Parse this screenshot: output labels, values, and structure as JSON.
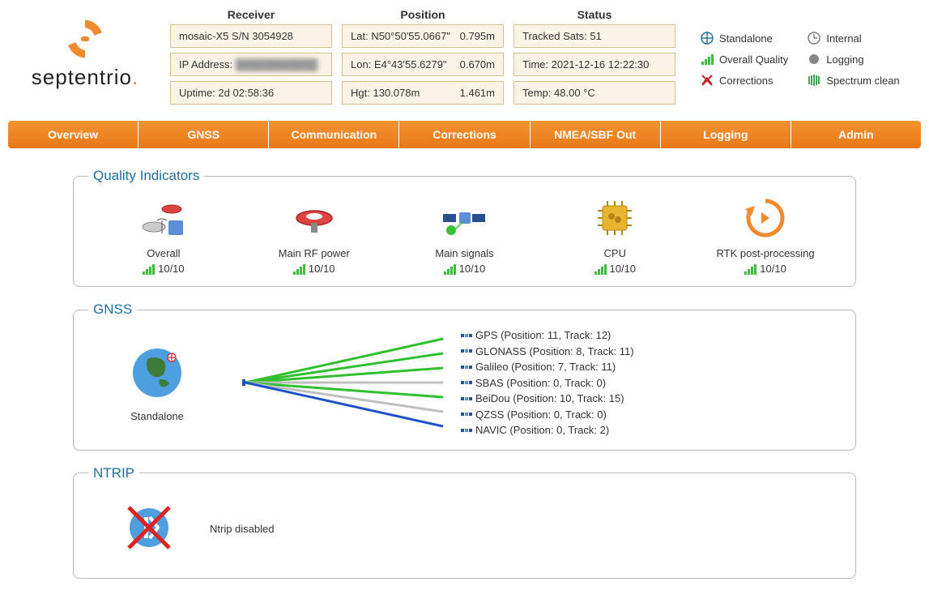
{
  "brand": "septentrio",
  "header": {
    "receiver_title": "Receiver",
    "position_title": "Position",
    "status_title": "Status",
    "receiver": {
      "model": "mosaic-X5 S/N 3054928",
      "ip_label": "IP Address:",
      "ip_value": "███████████",
      "uptime_label": "Uptime:",
      "uptime_value": "2d 02:58:36"
    },
    "position": {
      "lat_label": "Lat:",
      "lat_value": "N50°50'55.0667\"",
      "lat_acc": "0.795m",
      "lon_label": "Lon:",
      "lon_value": "E4°43'55.6279\"",
      "lon_acc": "0.670m",
      "hgt_label": "Hgt:",
      "hgt_value": "130.078m",
      "hgt_acc": "1.461m"
    },
    "status": {
      "sats_label": "Tracked Sats:",
      "sats_value": "51",
      "time_label": "Time:",
      "time_value": "2021-12-16 12:22:30",
      "temp_label": "Temp:",
      "temp_value": "48.00 °C"
    }
  },
  "legend": {
    "standalone": "Standalone",
    "overall": "Overall Quality",
    "corrections": "Corrections",
    "internal": "Internal",
    "logging": "Logging",
    "spectrum": "Spectrum clean"
  },
  "nav": {
    "overview": "Overview",
    "gnss": "GNSS",
    "communication": "Communication",
    "corrections": "Corrections",
    "nmea": "NMEA/SBF Out",
    "logging": "Logging",
    "admin": "Admin"
  },
  "quality": {
    "title": "Quality Indicators",
    "items": [
      {
        "label": "Overall",
        "score": "10/10"
      },
      {
        "label": "Main RF power",
        "score": "10/10"
      },
      {
        "label": "Main signals",
        "score": "10/10"
      },
      {
        "label": "CPU",
        "score": "10/10"
      },
      {
        "label": "RTK post-processing",
        "score": "10/10"
      }
    ]
  },
  "gnss": {
    "title": "GNSS",
    "mode": "Standalone",
    "constellations": [
      {
        "name": "GPS",
        "text": "GPS (Position: 11, Track: 12)",
        "color": "#2fbf2f"
      },
      {
        "name": "GLONASS",
        "text": "GLONASS (Position: 8, Track: 11)",
        "color": "#2fbf2f"
      },
      {
        "name": "Galileo",
        "text": "Galileo (Position: 7, Track: 11)",
        "color": "#2fbf2f"
      },
      {
        "name": "SBAS",
        "text": "SBAS (Position: 0, Track: 0)",
        "color": "#bfbfbf"
      },
      {
        "name": "BeiDou",
        "text": "BeiDou (Position: 10, Track: 15)",
        "color": "#2fbf2f"
      },
      {
        "name": "QZSS",
        "text": "QZSS (Position: 0, Track: 0)",
        "color": "#bfbfbf"
      },
      {
        "name": "NAVIC",
        "text": "NAVIC (Position: 0, Track: 2)",
        "color": "#1e52c7"
      }
    ]
  },
  "ntrip": {
    "title": "NTRIP",
    "status": "Ntrip disabled"
  }
}
